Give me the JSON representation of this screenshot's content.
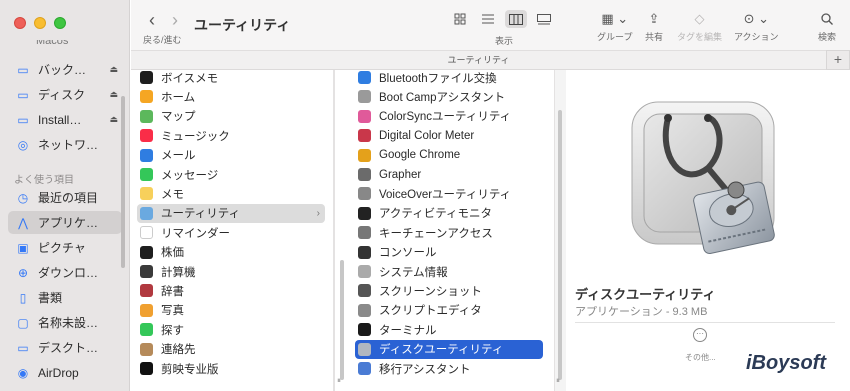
{
  "window": {
    "title": "ユーティリティ",
    "path_bar": "ユーティリティ",
    "add_tab": "+"
  },
  "toolbar": {
    "back_forward_label": "戻る/進む",
    "view_label": "表示",
    "group_label": "グループ",
    "share_label": "共有",
    "tag_label": "タグを編集",
    "action_label": "アクション",
    "search_label": "検索"
  },
  "sidebar": {
    "cut_top": "Macos",
    "locations": [
      {
        "label": "バック…",
        "icon": "drive-icon",
        "eject": "⏏"
      },
      {
        "label": "ディスク",
        "icon": "drive-icon",
        "eject": "⏏"
      },
      {
        "label": "Install…",
        "icon": "drive-icon",
        "eject": "⏏"
      },
      {
        "label": "ネットワ…",
        "icon": "globe-icon"
      }
    ],
    "favorites_heading": "よく使う項目",
    "favorites": [
      {
        "label": "最近の項目",
        "icon": "clock-icon"
      },
      {
        "label": "アプリケ…",
        "icon": "apps-icon",
        "selected": true
      },
      {
        "label": "ピクチャ",
        "icon": "photo-icon"
      },
      {
        "label": "ダウンロ…",
        "icon": "download-icon"
      },
      {
        "label": "書類",
        "icon": "document-icon"
      },
      {
        "label": "名称未設…",
        "icon": "folder-icon"
      },
      {
        "label": "デスクト…",
        "icon": "desktop-icon"
      },
      {
        "label": "AirDrop",
        "icon": "airdrop-icon"
      }
    ]
  },
  "applications_column": [
    {
      "label": "ボイスメモ",
      "color": "#1e1e1e"
    },
    {
      "label": "ホーム",
      "color": "#f5a623"
    },
    {
      "label": "マップ",
      "color": "#5cb85c"
    },
    {
      "label": "ミュージック",
      "color": "#fa2d48"
    },
    {
      "label": "メール",
      "color": "#2f7de1"
    },
    {
      "label": "メッセージ",
      "color": "#34c759"
    },
    {
      "label": "メモ",
      "color": "#f7d05b"
    },
    {
      "label": "ユーティリティ",
      "color": "#6aa9e0",
      "selected": true,
      "chevron": "›"
    },
    {
      "label": "リマインダー",
      "color": "#ffffff"
    },
    {
      "label": "株価",
      "color": "#1e1e1e"
    },
    {
      "label": "計算機",
      "color": "#3a3a3a"
    },
    {
      "label": "辞書",
      "color": "#b1393f"
    },
    {
      "label": "写真",
      "color": "#f0a030"
    },
    {
      "label": "探す",
      "color": "#34c759"
    },
    {
      "label": "連絡先",
      "color": "#b58a5a"
    },
    {
      "label": "剪映专业版",
      "color": "#111111"
    }
  ],
  "utilities_column": [
    {
      "label": "Bluetoothファイル交換",
      "color": "#2f7de1"
    },
    {
      "label": "Boot Campアシスタント",
      "color": "#9a9a9a"
    },
    {
      "label": "ColorSyncユーティリティ",
      "color": "#e05a9a"
    },
    {
      "label": "Digital Color Meter",
      "color": "#c9374a"
    },
    {
      "label": "Google Chrome",
      "color": "#e4a11b"
    },
    {
      "label": "Grapher",
      "color": "#6b6b6b"
    },
    {
      "label": "VoiceOverユーティリティ",
      "color": "#888888"
    },
    {
      "label": "アクティビティモニタ",
      "color": "#222222"
    },
    {
      "label": "キーチェーンアクセス",
      "color": "#777777"
    },
    {
      "label": "コンソール",
      "color": "#333333"
    },
    {
      "label": "システム情報",
      "color": "#aaaaaa"
    },
    {
      "label": "スクリーンショット",
      "color": "#555555"
    },
    {
      "label": "スクリプトエディタ",
      "color": "#8a8a8a"
    },
    {
      "label": "ターミナル",
      "color": "#1a1a1a"
    },
    {
      "label": "ディスクユーティリティ",
      "color": "#b0b7c0",
      "selected": true
    },
    {
      "label": "移行アシスタント",
      "color": "#4a7bd4"
    }
  ],
  "preview": {
    "name": "ディスクユーティリティ",
    "meta": "アプリケーション - 9.3 MB",
    "more_label": "その他..."
  },
  "watermark": "iBoysoft"
}
